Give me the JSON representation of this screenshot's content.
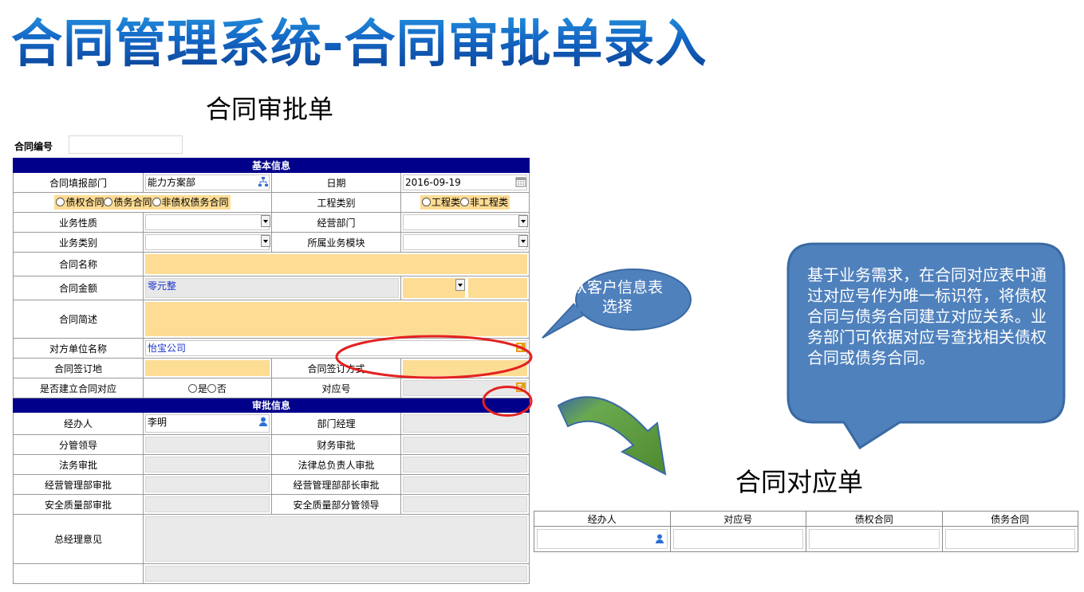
{
  "slide_title": "合同管理系统-合同审批单录入",
  "form_title": "合同审批单",
  "contract_no_label": "合同编号",
  "sections": {
    "basic": "基本信息",
    "approval": "审批信息"
  },
  "fields": {
    "dept_label": "合同填报部门",
    "dept_value": "能力方案部",
    "date_label": "日期",
    "date_value": "2016-09-19",
    "contract_type_options": [
      "债权合同",
      "债务合同",
      "非债权债务合同"
    ],
    "engineering_label": "工程类别",
    "engineering_options": [
      "工程类",
      "非工程类"
    ],
    "business_nature_label": "业务性质",
    "operating_dept_label": "经营部门",
    "business_category_label": "业务类别",
    "module_label": "所属业务模块",
    "name_label": "合同名称",
    "amount_label": "合同金额",
    "amount_value": "零元整",
    "summary_label": "合同简述",
    "counterparty_label": "对方单位名称",
    "counterparty_value": "怡宝公司",
    "sign_place_label": "合同签订地",
    "sign_method_label": "合同签订方式",
    "establish_corr_label": "是否建立合同对应",
    "yes_no_options": [
      "是",
      "否"
    ],
    "corr_no_label": "对应号"
  },
  "approval": {
    "handler_label": "经办人",
    "handler_value": "李明",
    "dept_manager_label": "部门经理",
    "leader_label": "分管领导",
    "finance_label": "财务审批",
    "legal_label": "法务审批",
    "legal_chief_label": "法律总负责人审批",
    "ops_dept_label": "经营管理部审批",
    "ops_minister_label": "经营管理部部长审批",
    "safety_label": "安全质量部审批",
    "safety_leader_label": "安全质量部分管领导",
    "gm_label": "总经理意见"
  },
  "callout_small": "从客户信息表选择",
  "callout_big": "基于业务需求，在合同对应表中通过对应号作为唯一标识符，将债权合同与债务合同建立对应关系。业务部门可依据对应号查找相关债权合同或债务合同。",
  "corr_title": "合同对应单",
  "corr_table": {
    "headers": [
      "经办人",
      "对应号",
      "债权合同",
      "债务合同"
    ]
  },
  "colors": {
    "section_bg": "#00008b",
    "required_bg": "#fddc94",
    "callout_fill": "#4f81bd",
    "highlight_red": "#e32121",
    "arrow_green": "#6aa84f"
  }
}
